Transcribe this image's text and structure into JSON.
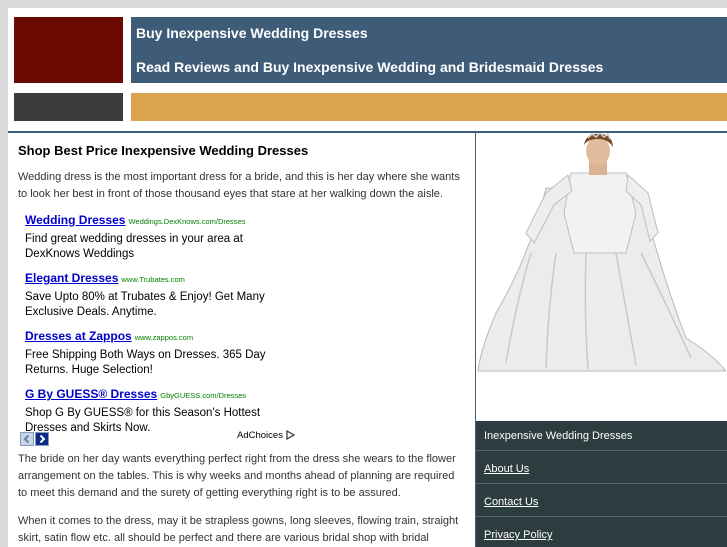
{
  "header": {
    "title": "Buy Inexpensive Wedding Dresses",
    "subtitle": "Read Reviews and Buy Inexpensive Wedding and Bridesmaid Dresses"
  },
  "main": {
    "heading": "Shop Best Price Inexpensive Wedding Dresses",
    "intro": "Wedding dress is the most important dress for a bride, and this is her day where she wants to look her best in front of those thousand eyes that stare at her walking down the aisle.",
    "ads": [
      {
        "title": "Wedding Dresses",
        "url": "Weddings.DexKnows.com/Dresses",
        "desc": "Find great wedding dresses in your area at DexKnows Weddings"
      },
      {
        "title": "Elegant Dresses",
        "url": "www.Trubates.com",
        "desc": "Save Upto 80% at Trubates & Enjoy! Get Many Exclusive Deals. Anytime."
      },
      {
        "title": "Dresses at Zappos",
        "url": "www.zappos.com",
        "desc": "Free Shipping Both Ways on Dresses. 365 Day Returns. Huge Selection!"
      },
      {
        "title": "G By GUESS® Dresses",
        "url": "GbyGUESS.com/Dresses",
        "desc": "Shop G By GUESS® for this Season's Hottest Dresses and Skirts Now."
      }
    ],
    "adchoices": "AdChoices",
    "para2": "The bride on her day wants everything perfect right from the dress she wears to the flower arrangement on the tables. This is why weeks and months ahead of planning are required to meet this demand and the surety of getting everything right is to be assured.",
    "para3": "When it comes to the dress, may it be strapless gowns, long sleeves, flowing train, straight skirt, satin flow etc. all should be perfect and there are various bridal shop with bridal"
  },
  "sidebar": {
    "heading": "Inexpensive Wedding Dresses",
    "links": [
      "About Us",
      "Contact Us",
      "Privacy Policy"
    ]
  },
  "colors": {
    "header_blue": "#3e5c77",
    "header_red": "#6b0a00",
    "gold_bar": "#dca44e",
    "sidebar_nav": "#2d3c3e"
  }
}
